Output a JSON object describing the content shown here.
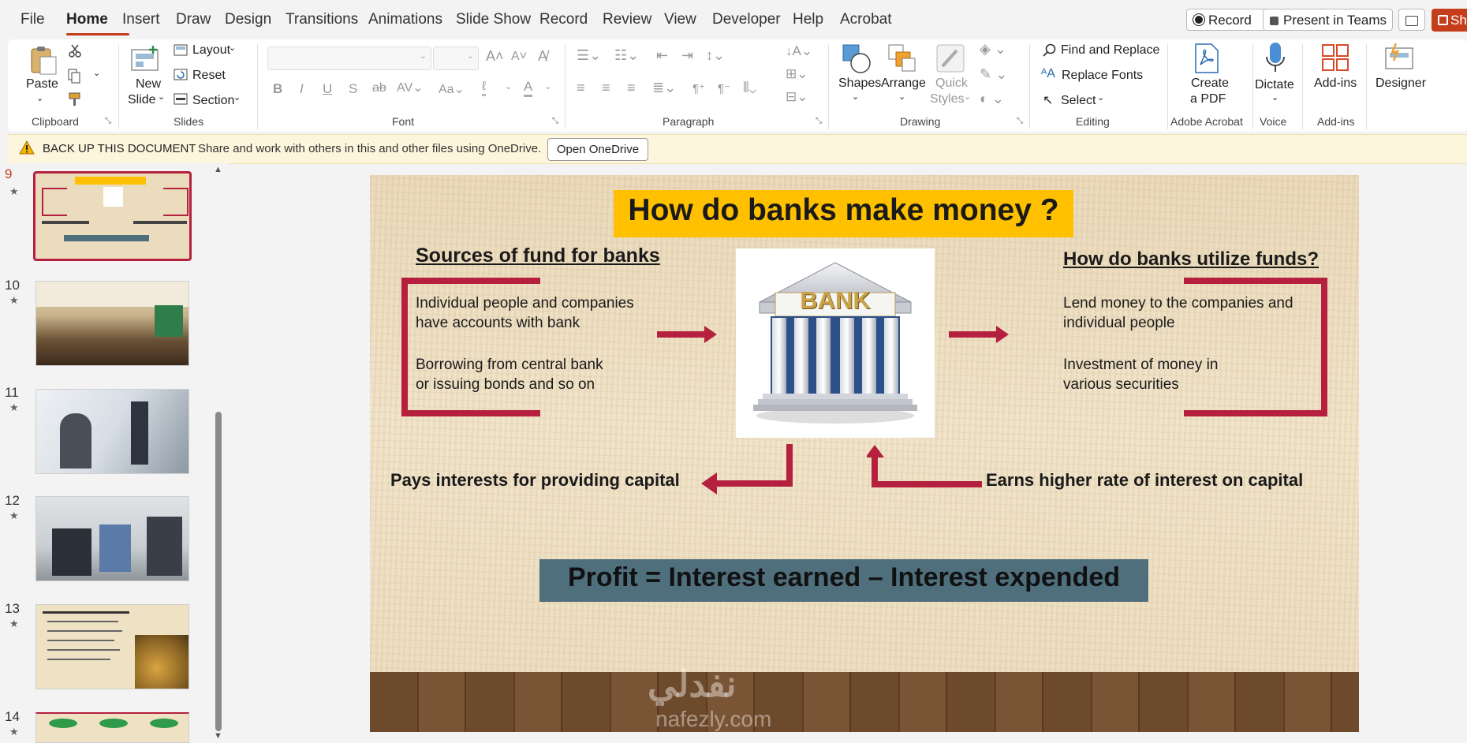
{
  "menubar": {
    "items": [
      "File",
      "Home",
      "Insert",
      "Draw",
      "Design",
      "Transitions",
      "Animations",
      "Slide Show",
      "Record",
      "Review",
      "View",
      "Developer",
      "Help",
      "Acrobat"
    ],
    "record_btn": "Record",
    "present_btn": "Present in Teams",
    "share_btn": "Sh"
  },
  "ribbon": {
    "clipboard": {
      "paste": "Paste",
      "label": "Clipboard"
    },
    "slides": {
      "new_slide_1": "New",
      "new_slide_2": "Slide",
      "layout": "Layout",
      "reset": "Reset",
      "section": "Section",
      "label": "Slides"
    },
    "font": {
      "label": "Font"
    },
    "paragraph": {
      "label": "Paragraph"
    },
    "drawing": {
      "shapes": "Shapes",
      "arrange": "Arrange",
      "quick_1": "Quick",
      "quick_2": "Styles",
      "label": "Drawing"
    },
    "editing": {
      "find": "Find and Replace",
      "replace_fonts": "Replace Fonts",
      "select": "Select",
      "label": "Editing"
    },
    "acrobat": {
      "create_1": "Create",
      "create_2": "a PDF",
      "label": "Adobe Acrobat"
    },
    "voice": {
      "dictate": "Dictate",
      "label": "Voice"
    },
    "addins": {
      "addins": "Add-ins",
      "label": "Add-ins"
    },
    "designer": {
      "designer": "Designer"
    }
  },
  "notification": {
    "title": "BACK UP THIS DOCUMENT",
    "message": "Share and work with others in this and other files using OneDrive.",
    "button": "Open OneDrive"
  },
  "thumbnails": [
    {
      "num": "9",
      "star": "★"
    },
    {
      "num": "10",
      "star": "★"
    },
    {
      "num": "11",
      "star": "★"
    },
    {
      "num": "12",
      "star": "★"
    },
    {
      "num": "13",
      "star": "★"
    },
    {
      "num": "14",
      "star": "★"
    }
  ],
  "slide": {
    "title": "How do banks make money ?",
    "sources_heading": "Sources of fund for banks",
    "sources_item1_l1": "Individual people and companies",
    "sources_item1_l2": "have accounts with bank",
    "sources_item2_l1": "Borrowing from central bank",
    "sources_item2_l2": "or issuing bonds and so on",
    "utilize_heading": "How do banks utilize funds?",
    "utilize_item1_l1": "Lend money to the companies and",
    "utilize_item1_l2": "individual people",
    "utilize_item2_l1": "Investment of money in",
    "utilize_item2_l2": "various securities",
    "bank_sign": "BANK",
    "pays_text": "Pays interests for providing capital",
    "earns_text": "Earns higher rate of interest on capital",
    "profit_text": "Profit = Interest earned – Interest expended",
    "watermark_arabic": "نفدلي",
    "watermark_latin": "nafezly.com"
  },
  "colors": {
    "accent": "#c43e1c",
    "title_bg": "#ffc000",
    "profit_bg": "#4f6f7d",
    "arrow_red": "#b5203e"
  }
}
